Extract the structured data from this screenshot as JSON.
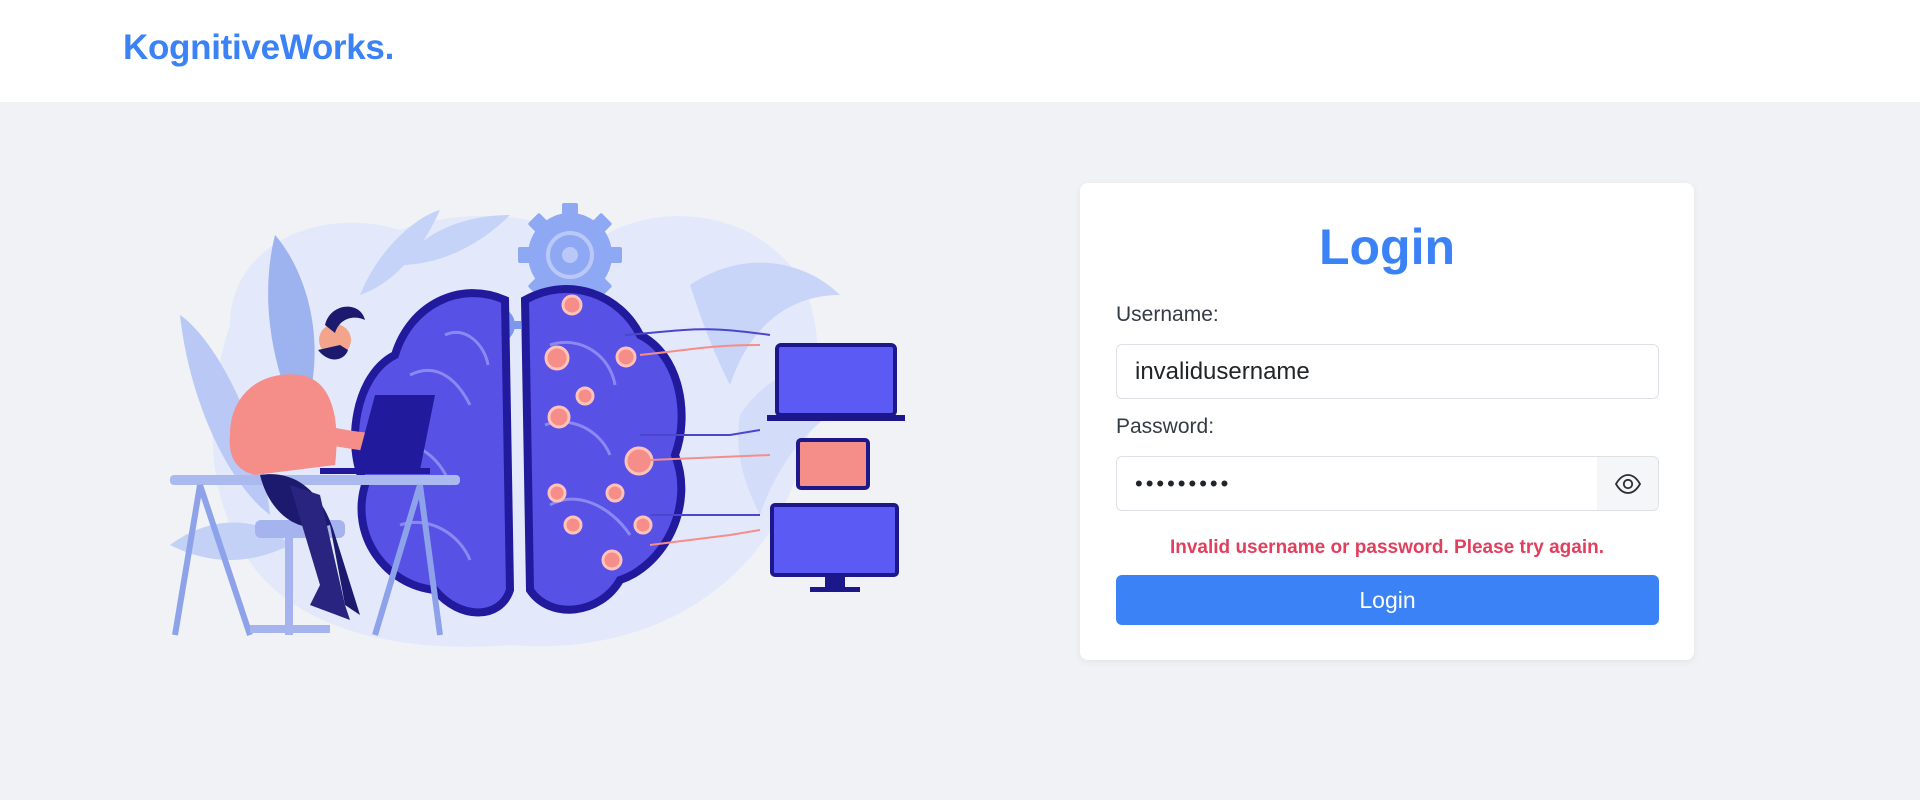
{
  "header": {
    "brand": "KognitiveWorks."
  },
  "illustration": {
    "name": "brain-computer-illustration"
  },
  "login": {
    "title": "Login",
    "username_label": "Username:",
    "username_value": "invalidusername",
    "password_label": "Password:",
    "password_value": "•••••••••",
    "error_message": "Invalid username or password. Please try again.",
    "submit_label": "Login",
    "toggle_icon": "eye-icon"
  },
  "colors": {
    "brand": "#3b82f6",
    "background": "#f0f2f6",
    "error": "#e0405e",
    "button": "#3b82f6"
  }
}
